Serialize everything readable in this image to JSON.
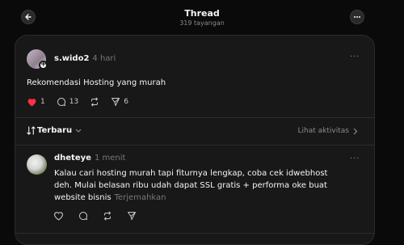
{
  "header": {
    "title": "Thread",
    "subtitle": "319 tayangan"
  },
  "post": {
    "username": "s.wido2",
    "time": "4 hari",
    "text": "Rekomendasi Hosting yang murah",
    "likes": "1",
    "replies": "13",
    "shares": "6"
  },
  "sort": {
    "label": "Terbaru",
    "activity_label": "Lihat aktivitas"
  },
  "reply": {
    "username": "dheteye",
    "time": "1 menit",
    "text": "Kalau cari hosting murah tapi fiturnya lengkap, coba cek idwebhost deh. Mulai belasan ribu udah dapat SSL gratis + performa oke buat website bisnis",
    "translate_label": "Terjemahkan"
  },
  "colors": {
    "background": "#0a0a0a",
    "panel": "#181818",
    "like_active": "#ff3040"
  }
}
